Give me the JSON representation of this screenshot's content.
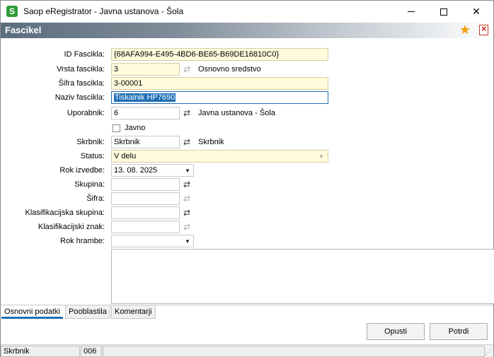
{
  "window": {
    "app_icon_letter": "S",
    "title": "Saop eRegistrator - Javna ustanova - Šola",
    "minimize_label": "",
    "maximize_label": "",
    "close_label": "✕"
  },
  "header": {
    "title": "Fascikel",
    "star_icon": "star-icon",
    "delete_icon": "delete-icon"
  },
  "form": {
    "id_fascikla": {
      "label": "ID Fascikla:",
      "value": "{68AFA994-E495-4BD6-BE65-B69DE16810C0}"
    },
    "vrsta_fascikla": {
      "label": "Vrsta fascikla:",
      "value": "3",
      "description": "Osnovno sredstvo"
    },
    "sifra_fascikla": {
      "label": "Šifra fascikla:",
      "value": "3-00001"
    },
    "naziv_fascikla": {
      "label": "Naziv fascikla:",
      "value": "Tiskalnik HP7690"
    },
    "uporabnik": {
      "label": "Uporabnik:",
      "value": "6",
      "description": "Javna ustanova - Šola"
    },
    "javno": {
      "label": "Javno",
      "checked": false
    },
    "skrbnik": {
      "label": "Skrbnik:",
      "value": "Skrbnik",
      "description": "Skrbnik"
    },
    "status": {
      "label": "Status:",
      "value": "V delu"
    },
    "rok_izvedbe": {
      "label": "Rok izvedbe:",
      "value": "13. 08. 2025"
    },
    "skupina": {
      "label": "Skupina:",
      "value": ""
    },
    "sifra": {
      "label": "Šifra:",
      "value": ""
    },
    "klasifikacijska_skupina": {
      "label": "Klasifikacijska skupina:",
      "value": ""
    },
    "klasifikacijski_znak": {
      "label": "Klasifikacijski znak:",
      "value": ""
    },
    "rok_hrambe": {
      "label": "Rok hrambe:",
      "value": ""
    }
  },
  "tabs": [
    {
      "label": "Osnovni podatki",
      "active": true
    },
    {
      "label": "Pooblastila",
      "active": false
    },
    {
      "label": "Komentarji",
      "active": false
    }
  ],
  "buttons": {
    "cancel": "Opusti",
    "confirm": "Potrdi"
  },
  "statusbar": {
    "user": "Skrbnik",
    "code": "006"
  }
}
